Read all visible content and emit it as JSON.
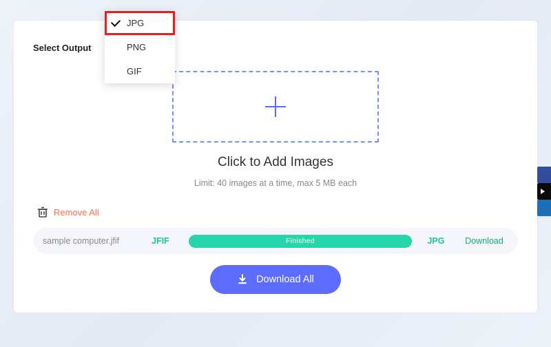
{
  "select_output_label": "Select Output",
  "dropdown": {
    "options": [
      "JPG",
      "PNG",
      "GIF"
    ],
    "selected": "JPG"
  },
  "dropzone": {
    "heading": "Click to Add Images",
    "limit_text": "Limit: 40 images at a time, max 5 MB each"
  },
  "remove_all_label": "Remove All",
  "file": {
    "name": "sample computer.jfif",
    "source_format": "JFIF",
    "progress_label": "Finished",
    "target_format": "JPG",
    "download_label": "Download"
  },
  "download_all_label": "Download All",
  "colors": {
    "accent_blue": "#5b6cff",
    "accent_teal": "#25d6a8",
    "accent_orange": "#ff6a4d",
    "highlight_red": "#ef1b1b"
  }
}
